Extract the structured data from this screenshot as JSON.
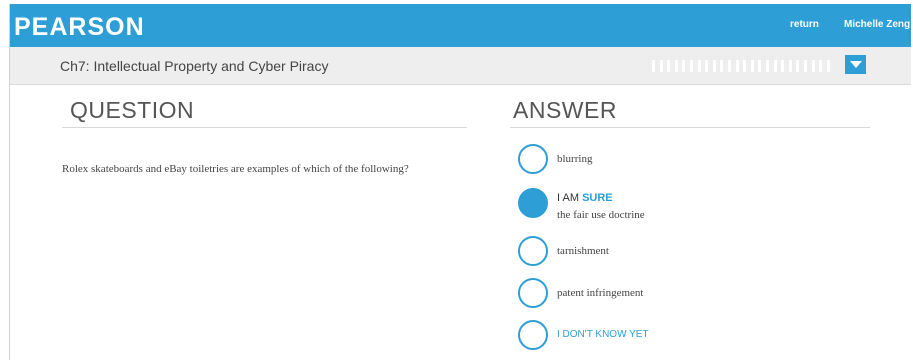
{
  "header": {
    "brand": "PEARSON",
    "return_label": "return",
    "user_name": "Michelle Zeng"
  },
  "subheader": {
    "chapter_title": "Ch7: Intellectual Property and Cyber Piracy",
    "progress_segments": 24,
    "accent": "#2d9fd6"
  },
  "question": {
    "heading": "QUESTION",
    "text": "Rolex skateboards and eBay toiletries are examples of which of the following?"
  },
  "answer": {
    "heading": "ANSWER",
    "options": [
      {
        "label": "blurring",
        "selected": false
      },
      {
        "confidence_prefix": "I AM",
        "confidence_emphasis": "SURE",
        "label": "the fair use doctrine",
        "selected": true
      },
      {
        "label": "tarnishment",
        "selected": false
      },
      {
        "label": "patent infringement",
        "selected": false
      }
    ],
    "dont_know_label": "I DON'T KNOW YET"
  }
}
